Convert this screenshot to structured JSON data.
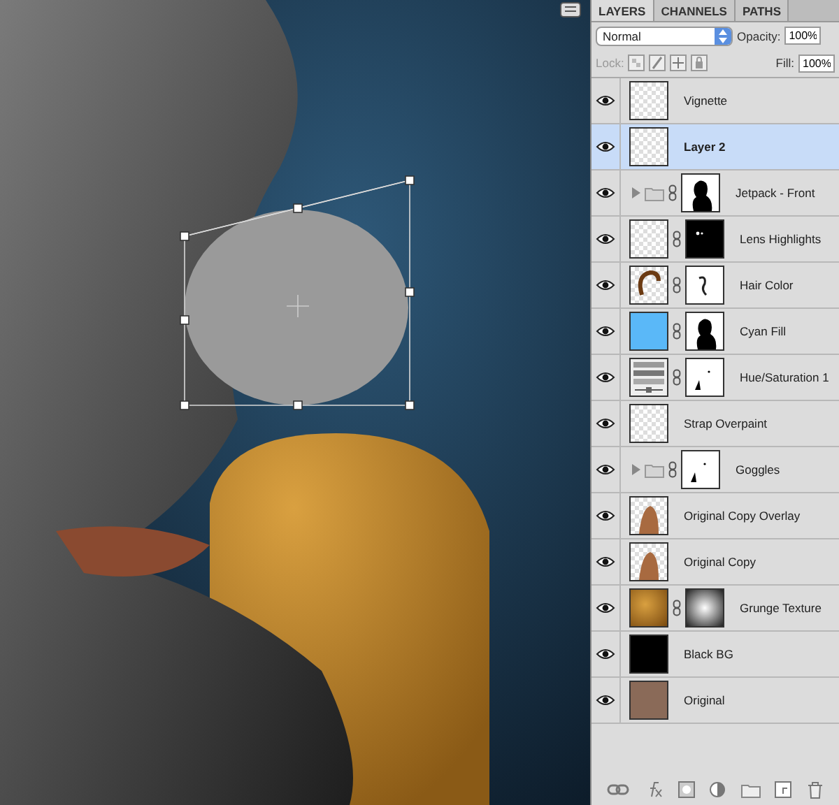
{
  "tabs": [
    {
      "label": "LAYERS",
      "selected": true
    },
    {
      "label": "CHANNELS",
      "selected": false
    },
    {
      "label": "PATHS",
      "selected": false
    }
  ],
  "blend_mode": {
    "value": "Normal"
  },
  "opacity": {
    "label": "Opacity:",
    "value": "100%"
  },
  "lock": {
    "label": "Lock:"
  },
  "fill": {
    "label": "Fill:",
    "value": "100%"
  },
  "layers": [
    {
      "name": "Vignette",
      "selected": false,
      "visible": true,
      "group": false,
      "thumbnail": {
        "kind": "transparent"
      }
    },
    {
      "name": "Layer 2",
      "selected": true,
      "visible": true,
      "group": false,
      "thumbnail": {
        "kind": "transparent"
      }
    },
    {
      "name": "Jetpack - Front",
      "selected": false,
      "visible": true,
      "group": true,
      "mask": {
        "kind": "silhouette"
      }
    },
    {
      "name": "Lens Highlights",
      "selected": false,
      "visible": true,
      "group": false,
      "thumbnail": {
        "kind": "transparent"
      },
      "mask": {
        "kind": "dots"
      }
    },
    {
      "name": "Hair Color",
      "selected": false,
      "visible": true,
      "group": false,
      "thumbnail": {
        "kind": "hair"
      },
      "mask": {
        "kind": "stroke"
      }
    },
    {
      "name": "Cyan Fill",
      "selected": false,
      "visible": true,
      "group": false,
      "thumbnail": {
        "kind": "cyan"
      },
      "mask": {
        "kind": "silhouette"
      }
    },
    {
      "name": "Hue/Saturation 1",
      "selected": false,
      "visible": true,
      "group": false,
      "thumbnail": {
        "kind": "adjustment"
      },
      "mask": {
        "kind": "speck"
      }
    },
    {
      "name": "Strap Overpaint",
      "selected": false,
      "visible": true,
      "group": false,
      "thumbnail": {
        "kind": "transparent"
      }
    },
    {
      "name": "Goggles",
      "selected": false,
      "visible": true,
      "group": true,
      "mask": {
        "kind": "speck"
      }
    },
    {
      "name": "Original Copy Overlay",
      "selected": false,
      "visible": true,
      "group": false,
      "thumbnail": {
        "kind": "portrait"
      }
    },
    {
      "name": "Original Copy",
      "selected": false,
      "visible": true,
      "group": false,
      "thumbnail": {
        "kind": "portrait"
      }
    },
    {
      "name": "Grunge Texture",
      "selected": false,
      "visible": true,
      "group": false,
      "thumbnail": {
        "kind": "texture"
      },
      "mask": {
        "kind": "gradient"
      }
    },
    {
      "name": "Black BG",
      "selected": false,
      "visible": true,
      "group": false,
      "thumbnail": {
        "kind": "black"
      }
    },
    {
      "name": "Original",
      "selected": false,
      "visible": true,
      "group": false,
      "thumbnail": {
        "kind": "photo"
      }
    }
  ]
}
